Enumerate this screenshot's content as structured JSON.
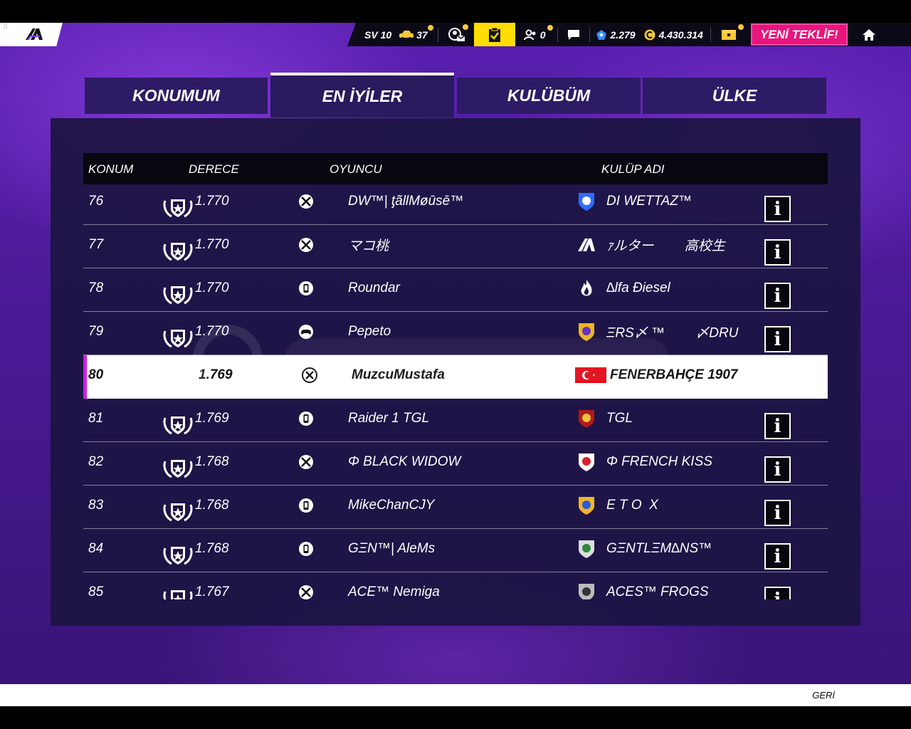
{
  "topbar": {
    "sv_label": "SV 10",
    "cars_count": "37",
    "friends_count": "0",
    "tokens": "2.279",
    "credits": "4.430.314",
    "offer_label": "YENİ TEKLİF!"
  },
  "tabs": [
    {
      "label": "KONUMUM"
    },
    {
      "label": "EN İYİLER"
    },
    {
      "label": "KULÜBÜM"
    },
    {
      "label": "ÜLKE"
    }
  ],
  "table": {
    "headers": {
      "rank": "KONUM",
      "rating": "DERECE",
      "player": "OYUNCU",
      "club": "KULÜP ADI"
    },
    "rows": [
      {
        "rank": "76",
        "rating": "1.770",
        "platform": "xbox-icon",
        "player": "DW™| ƫãllMøūsē™",
        "club": "DI WETTAZ™",
        "club_icon": "flame-shield-icon"
      },
      {
        "rank": "77",
        "rating": "1.770",
        "platform": "xbox-icon",
        "player": "マコ桃",
        "club": "ｧルター　　 高校生",
        "club_icon": "asphalt-logo-icon"
      },
      {
        "rank": "78",
        "rating": "1.770",
        "platform": "mobile-icon",
        "player": "Roundar",
        "club": "∆lfa Điesel",
        "club_icon": "flame-icon"
      },
      {
        "rank": "79",
        "rating": "1.770",
        "platform": "gamepad-icon",
        "player": "Pepeto",
        "club": "ΞRS〆 ™　　 〆DRU",
        "club_icon": "helmet-crest-icon"
      },
      {
        "rank": "80",
        "rating": "1.769",
        "platform": "xbox-icon",
        "player": "MuzcuMustafa",
        "club": "FENERBAHÇE 1907",
        "club_icon": "turkey-flag-icon",
        "me": true
      },
      {
        "rank": "81",
        "rating": "1.769",
        "platform": "mobile-icon",
        "player": "Raider 1 TGL",
        "club": "TGL",
        "club_icon": "skull-crest-icon"
      },
      {
        "rank": "82",
        "rating": "1.768",
        "platform": "xbox-icon",
        "player": "Φ BLACK WIDOW",
        "club": "Φ FRENCH KISS",
        "club_icon": "flag-shield-icon"
      },
      {
        "rank": "83",
        "rating": "1.768",
        "platform": "mobile-icon",
        "player": "MikeChanCJY",
        "club": "E T O  X",
        "club_icon": "gold-crest-icon"
      },
      {
        "rank": "84",
        "rating": "1.768",
        "platform": "mobile-icon",
        "player": "GΞN™| AleMs",
        "club": "GΞNTLΞM∆NS™",
        "club_icon": "round-emblem-icon"
      },
      {
        "rank": "85",
        "rating": "1.767",
        "platform": "xbox-icon",
        "player": "ACE™ Nemiga",
        "club": "ACES™ FROGS",
        "club_icon": "frog-crest-icon"
      }
    ]
  },
  "footer": {
    "back_label": "GERİ"
  },
  "colors": {
    "accent_yellow": "#ffdd00",
    "offer_pink": "#e8157d",
    "highlight_bar": "#d21ee6"
  }
}
